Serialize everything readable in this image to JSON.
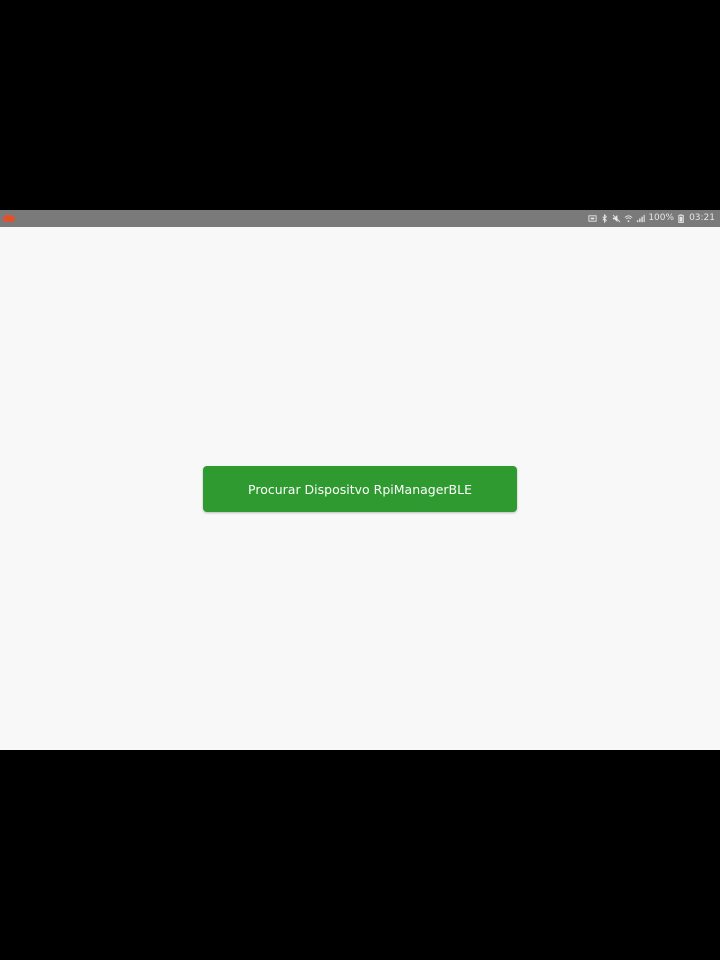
{
  "status_bar": {
    "notification_icon": "app-notification-icon",
    "battery_percent": "100%",
    "time": "03:21",
    "icons": [
      "screenshot-icon",
      "bluetooth-icon",
      "mute-icon",
      "wifi-icon",
      "signal-icon",
      "battery-icon"
    ]
  },
  "main": {
    "scan_button_label": "Procurar Dispositvo RpiManagerBLE"
  },
  "colors": {
    "background": "#f8f8f8",
    "status_bar": "#7a7a7a",
    "button": "#2e9a30",
    "notification_accent": "#e0522c"
  }
}
